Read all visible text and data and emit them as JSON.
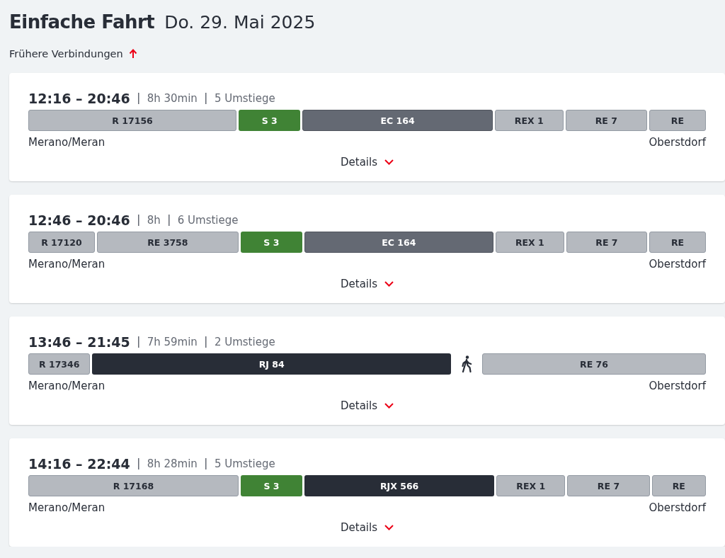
{
  "header": {
    "title": "Einfache Fahrt",
    "date": "Do. 29. Mai 2025"
  },
  "earlier_link": {
    "label": "Frühere Verbindungen"
  },
  "connections": [
    {
      "time": "12:16 – 20:46",
      "duration": "8h 30min",
      "transfers": "5 Umstiege",
      "origin": "Merano/Meran",
      "destination": "Oberstdorf",
      "details": "Details",
      "segments": [
        {
          "label": "R 17156",
          "kind": "regional"
        },
        {
          "label": "S 3",
          "kind": "sbahn"
        },
        {
          "label": "EC 164",
          "kind": "intercity"
        },
        {
          "label": "REX 1",
          "kind": "regional"
        },
        {
          "label": "RE 7",
          "kind": "regional"
        },
        {
          "label": "RE",
          "kind": "regional"
        }
      ]
    },
    {
      "time": "12:46 – 20:46",
      "duration": "8h",
      "transfers": "6 Umstiege",
      "origin": "Merano/Meran",
      "destination": "Oberstdorf",
      "details": "Details",
      "segments": [
        {
          "label": "R 17120",
          "kind": "regional"
        },
        {
          "label": "RE 3758",
          "kind": "regional"
        },
        {
          "label": "S 3",
          "kind": "sbahn"
        },
        {
          "label": "EC 164",
          "kind": "intercity"
        },
        {
          "label": "REX 1",
          "kind": "regional"
        },
        {
          "label": "RE 7",
          "kind": "regional"
        },
        {
          "label": "RE",
          "kind": "regional"
        }
      ]
    },
    {
      "time": "13:46 – 21:45",
      "duration": "7h 59min",
      "transfers": "2 Umstiege",
      "origin": "Merano/Meran",
      "destination": "Oberstdorf",
      "details": "Details",
      "segments": [
        {
          "label": "R 17346",
          "kind": "regional"
        },
        {
          "label": "RJ 84",
          "kind": "railjet"
        },
        {
          "kind": "walk"
        },
        {
          "label": "RE 76",
          "kind": "regional"
        }
      ]
    },
    {
      "time": "14:16 – 22:44",
      "duration": "8h 28min",
      "transfers": "5 Umstiege",
      "origin": "Merano/Meran",
      "destination": "Oberstdorf",
      "details": "Details",
      "segments": [
        {
          "label": "R 17168",
          "kind": "regional"
        },
        {
          "label": "S 3",
          "kind": "sbahn"
        },
        {
          "label": "RJX 566",
          "kind": "railjet"
        },
        {
          "label": "REX 1",
          "kind": "regional"
        },
        {
          "label": "RE 7",
          "kind": "regional"
        },
        {
          "label": "RE",
          "kind": "regional"
        }
      ]
    }
  ]
}
